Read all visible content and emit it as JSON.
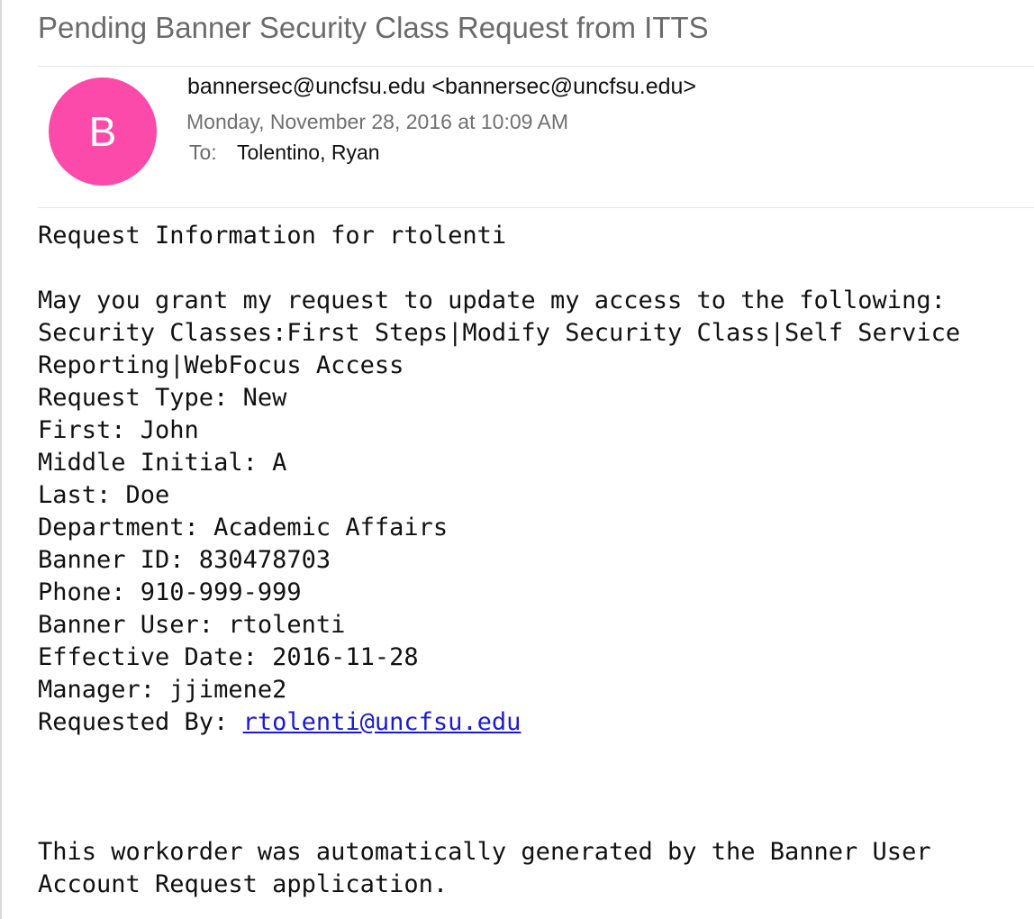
{
  "email": {
    "subject": "Pending Banner Security Class Request from ITTS",
    "avatar_letter": "B",
    "avatar_color": "#fc4aaa",
    "from": "bannersec@uncfsu.edu <bannersec@uncfsu.edu>",
    "date": "Monday, November 28, 2016 at 10:09 AM",
    "to_label": "To:",
    "to_value": "Tolentino, Ryan"
  },
  "body": {
    "heading": "Request Information for rtolenti",
    "intro": "May you grant my request to update my access to the following:",
    "security_classes_line1": "Security Classes:First Steps|Modify Security Class|Self Service",
    "security_classes_line2": "Reporting|WebFocus Access",
    "request_type": "Request Type: New",
    "first": "First: John",
    "middle_initial": "Middle Initial: A",
    "last": "Last: Doe",
    "department": "Department: Academic Affairs",
    "banner_id": "Banner ID: 830478703",
    "phone": "Phone: 910-999-999",
    "banner_user": "Banner User: rtolenti",
    "effective_date": "Effective Date: 2016-11-28",
    "manager": "Manager: jjimene2",
    "requested_by_label": "Requested By: ",
    "requested_by_link": "rtolenti@uncfsu.edu"
  },
  "footer": {
    "line1": "This workorder was automatically generated by the Banner User",
    "line2": "Account Request application."
  }
}
